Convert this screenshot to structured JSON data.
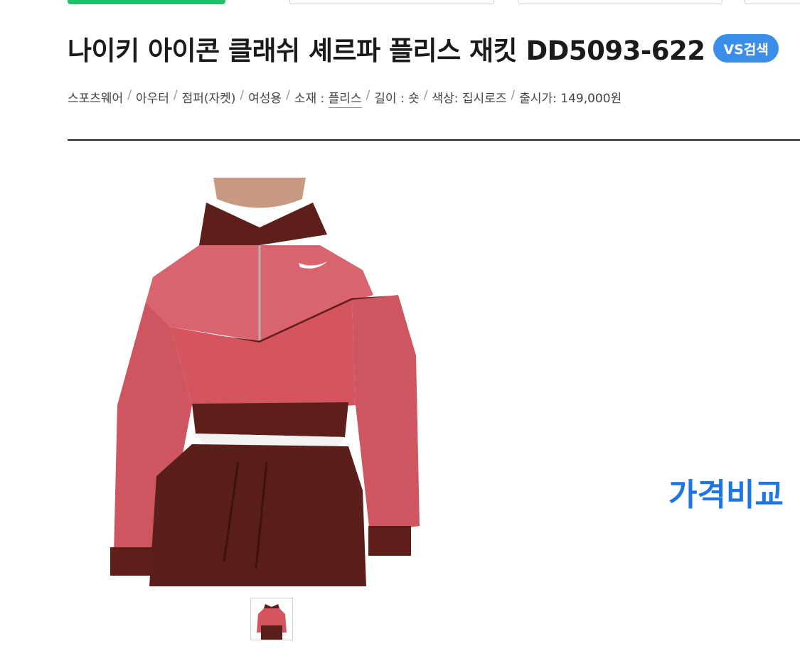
{
  "header": {
    "title": "나이키 아이콘 클래쉬 셰르파 플리스 재킷 DD5093-622",
    "vs_badge": "VS검색"
  },
  "specs": [
    {
      "text": "스포츠웨어"
    },
    {
      "text": "아우터"
    },
    {
      "text": "점퍼(자켓)"
    },
    {
      "text": "여성용"
    },
    {
      "text": "소재 : 플리스"
    },
    {
      "text": "길이 : 숏"
    },
    {
      "text": "색상: 집시로즈"
    },
    {
      "text": "출시가: 149,000원"
    }
  ],
  "spec_parts": {
    "material_label": "소재 : ",
    "material_value": "플리스"
  },
  "colors": {
    "accent_green": "#1fc26a",
    "badge_blue": "#3a8de8",
    "price_compare_blue": "#1e76e6",
    "jacket_pink": "#d9636f",
    "jacket_brown": "#5e1f1a"
  },
  "main": {
    "price_compare_label": "가격비교"
  }
}
